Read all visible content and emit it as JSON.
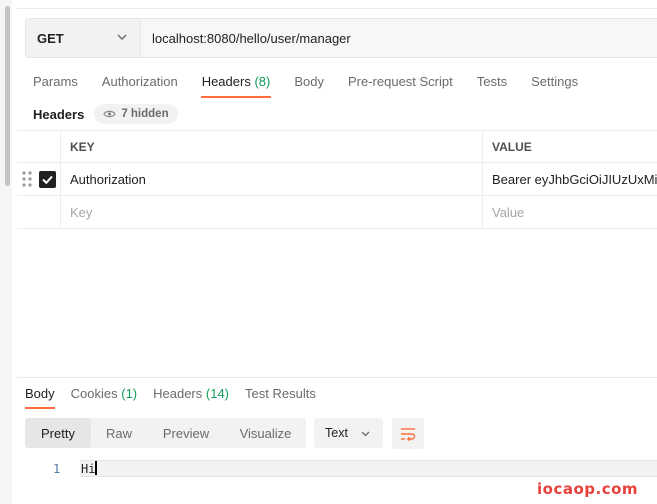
{
  "request": {
    "method": "GET",
    "url": "localhost:8080/hello/user/manager"
  },
  "tabs": [
    {
      "label": "Params"
    },
    {
      "label": "Authorization"
    },
    {
      "label": "Headers",
      "count": "(8)"
    },
    {
      "label": "Body"
    },
    {
      "label": "Pre-request Script"
    },
    {
      "label": "Tests"
    },
    {
      "label": "Settings"
    }
  ],
  "headers_section": {
    "label": "Headers",
    "hidden_label": "7 hidden",
    "columns": {
      "key": "KEY",
      "value": "VALUE"
    },
    "rows": [
      {
        "key": "Authorization",
        "value": "Bearer eyJhbGciOiJIUzUxMiJ",
        "checked": true
      }
    ],
    "new_row": {
      "key_placeholder": "Key",
      "value_placeholder": "Value"
    }
  },
  "response": {
    "tabs": [
      {
        "label": "Body"
      },
      {
        "label": "Cookies",
        "count": "(1)"
      },
      {
        "label": "Headers",
        "count": "(14)"
      },
      {
        "label": "Test Results"
      }
    ],
    "views": [
      "Pretty",
      "Raw",
      "Preview",
      "Visualize"
    ],
    "format": "Text",
    "lines": [
      {
        "num": "1",
        "text": "Hi"
      }
    ]
  },
  "watermark": "iocaop.com",
  "colors": {
    "accent": "#ff6c37",
    "count_green": "#0f9d58"
  }
}
